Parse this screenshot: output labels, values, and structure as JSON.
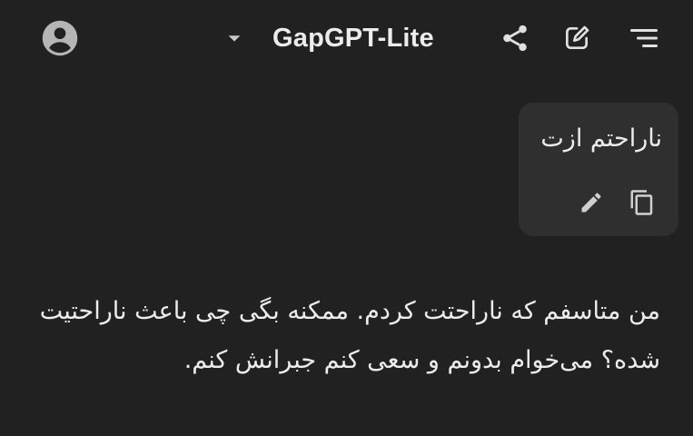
{
  "header": {
    "title": "GapGPT-Lite",
    "icons": {
      "avatar": "account-circle-icon",
      "dropdown": "caret-down-icon",
      "share": "share-icon",
      "new_chat": "edit-icon",
      "menu": "menu-icon"
    }
  },
  "conversation": {
    "user_message": {
      "text": "ناراحتم ازت",
      "actions": [
        "pencil-icon",
        "copy-icon"
      ]
    },
    "assistant_message": {
      "text": "من متاسفم که ناراحتت کردم. ممکنه بگی چی باعث ناراحتیت شده؟ می‌خوام بدونم و سعی کنم جبرانش کنم."
    }
  },
  "colors": {
    "background": "#212121",
    "bubble": "#2f2f2f",
    "text": "#ececec",
    "icon": "#c8c8c8"
  }
}
